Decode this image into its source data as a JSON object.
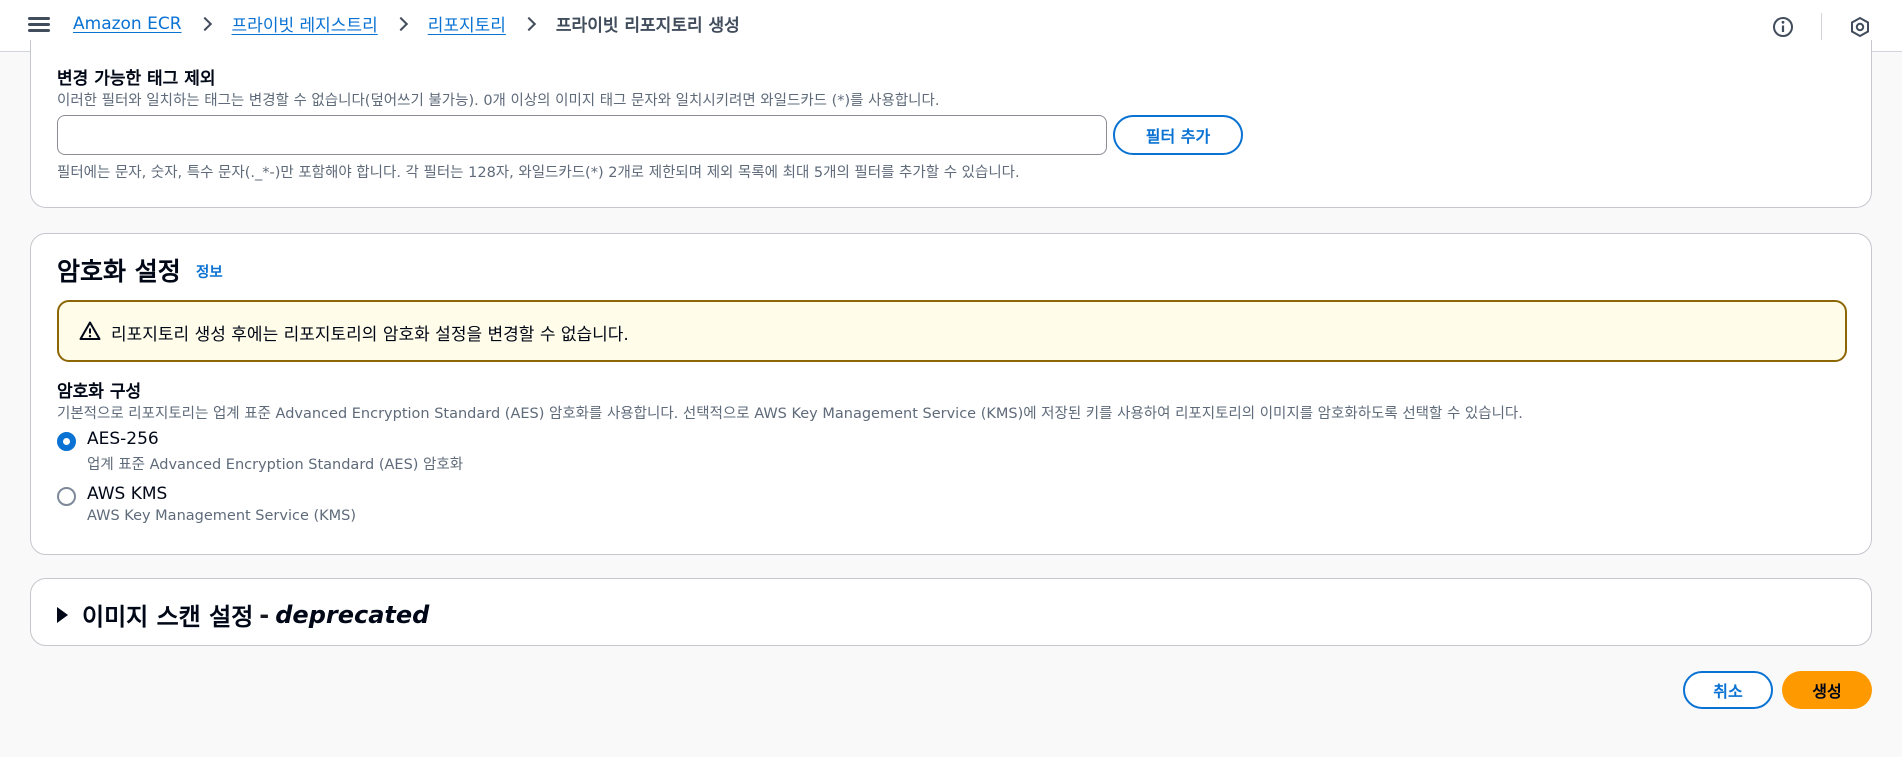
{
  "breadcrumb": {
    "items": [
      "Amazon ECR",
      "프라이빗 레지스트리",
      "리포지토리"
    ],
    "current": "프라이빗 리포지토리 생성"
  },
  "icons": {
    "menu": "hamburger-menu-icon",
    "info": "info-circle-icon",
    "notifications": "hexagon-notification-icon",
    "warning": "warning-triangle-icon"
  },
  "immutable_exclusion": {
    "label": "변경 가능한 태그 제외",
    "description": "이러한 필터와 일치하는 태그는 변경할 수 없습니다(덮어쓰기 불가능). 0개 이상의 이미지 태그 문자와 일치시키려면 와일드카드 (*)를 사용합니다.",
    "input_value": "",
    "input_placeholder": "",
    "add_filter_label": "필터 추가",
    "constraint": "필터에는 문자, 숫자, 특수 문자(._*-)만 포함해야 합니다. 각 필터는 128자, 와일드카드(*) 2개로 제한되며 제외 목록에 최대 5개의 필터를 추가할 수 있습니다."
  },
  "encryption": {
    "title": "암호화 설정",
    "info_label": "정보",
    "alert_text": "리포지토리 생성 후에는 리포지토리의 암호화 설정을 변경할 수 없습니다.",
    "config_label": "암호화 구성",
    "config_description": "기본적으로 리포지토리는 업계 표준 Advanced Encryption Standard (AES) 암호화를 사용합니다. 선택적으로 AWS Key Management Service (KMS)에 저장된 키를 사용하여 리포지토리의 이미지를 암호화하도록 선택할 수 있습니다.",
    "options": [
      {
        "label": "AES-256",
        "description": "업계 표준 Advanced Encryption Standard (AES) 암호화",
        "selected": true
      },
      {
        "label": "AWS KMS",
        "description": "AWS Key Management Service (KMS)",
        "selected": false
      }
    ]
  },
  "image_scan": {
    "title": "이미지 스캔 설정",
    "dash": "-",
    "deprecated": "deprecated"
  },
  "footer": {
    "cancel_label": "취소",
    "create_label": "생성"
  },
  "colors": {
    "link": "#0972d3",
    "primary": "#ff9900",
    "warning_border": "#8d6605",
    "warning_bg": "#fffce9"
  }
}
